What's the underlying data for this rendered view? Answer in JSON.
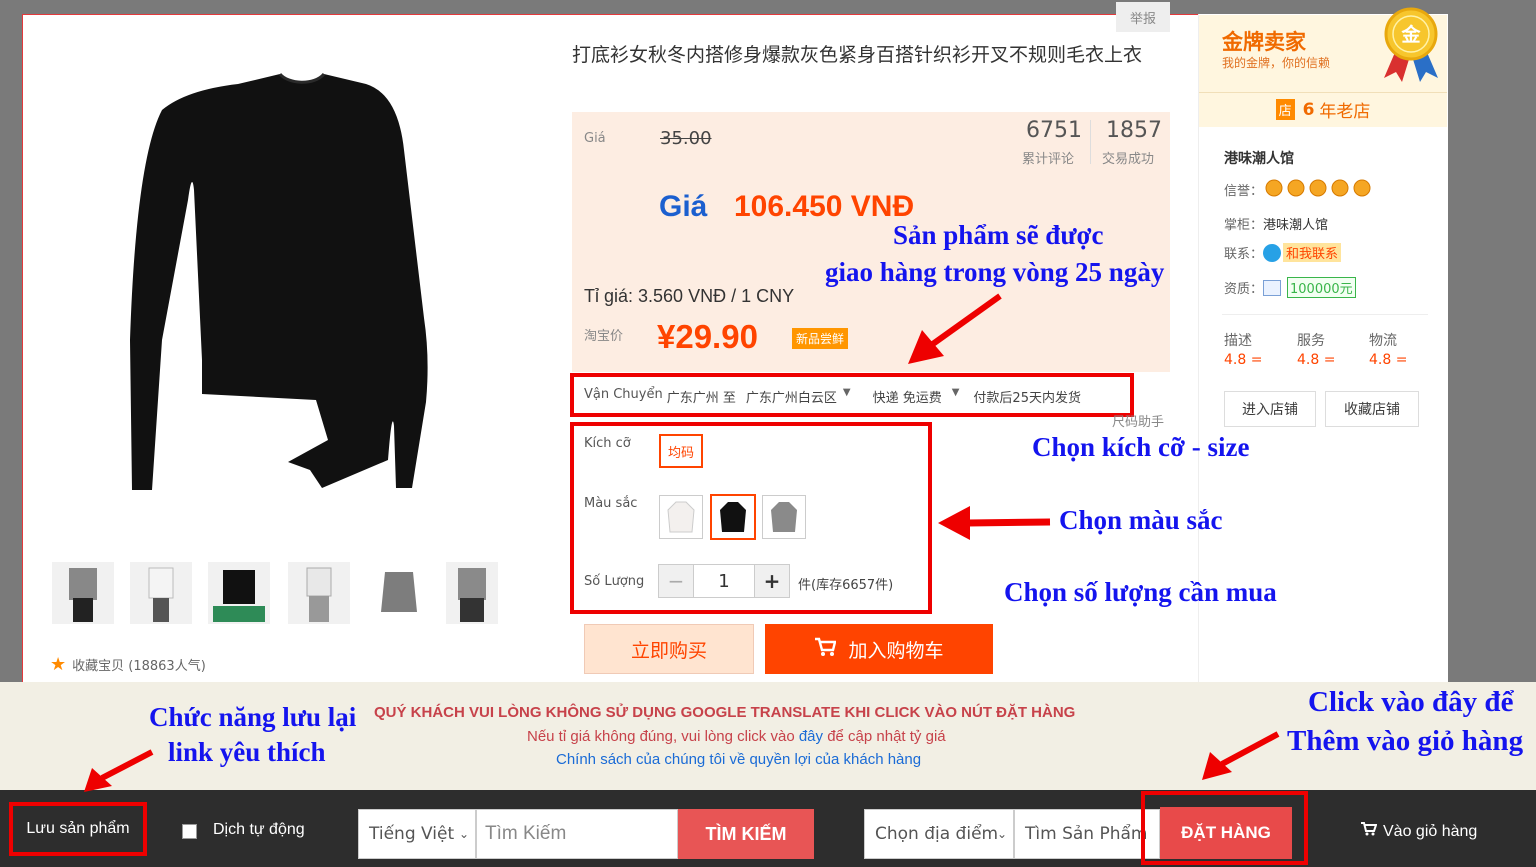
{
  "report": "举报",
  "product": {
    "title": "打底衫女秋冬内搭修身爆款灰色紧身百搭针织衫开叉不规则毛衣上衣"
  },
  "price": {
    "label": "Giá",
    "original": "35.00",
    "reviews_count": "6751",
    "reviews_label": "累计评论",
    "deals_count": "1857",
    "deals_label": "交易成功",
    "vnd_label": "Giá",
    "vnd_value": "106.450 VNĐ",
    "rate_text": "Tỉ giá: 3.560 VNĐ / 1 CNY",
    "taobao_label": "淘宝价",
    "taobao_price": "¥29.90",
    "new_tag": "新品尝鲜"
  },
  "shipping": {
    "label": "Vận Chuyển",
    "from": "广东广州 至",
    "to": "广东广州白云区",
    "method": "快递 免运费",
    "delivery": "付款后25天内发货",
    "size_helper": "尺码助手"
  },
  "options": {
    "size_label": "Kích cỡ",
    "size_value": "均码",
    "color_label": "Màu sắc",
    "qty_label": "Số Lượng",
    "qty_value": "1",
    "qty_minus": "−",
    "qty_plus": "+",
    "stock": "件(库存6657件)"
  },
  "actions": {
    "buy_now": "立即购买",
    "add_cart": "加入购物车"
  },
  "favorite": {
    "text": "收藏宝贝 (18863人气)"
  },
  "seller": {
    "badge_title": "金牌卖家",
    "badge_sub": "我的金牌，你的信赖",
    "badge_medal": "金",
    "years_icon": "店",
    "years_num": "6",
    "years_text": "年老店",
    "name": "港味潮人馆",
    "credit_label": "信誉：",
    "keeper_label": "掌柜：",
    "keeper_value": "港味潮人馆",
    "contact_label": "联系：",
    "contact_value": "和我联系",
    "qual_label": "资质：",
    "deposit": "100000元",
    "ratings": [
      {
        "label": "描述",
        "value": "4.8 ="
      },
      {
        "label": "服务",
        "value": "4.8 ="
      },
      {
        "label": "物流",
        "value": "4.8 ="
      }
    ],
    "enter_shop": "进入店铺",
    "save_shop": "收藏店铺"
  },
  "annotations": {
    "ship_line1": "Sản phẩm sẽ được",
    "ship_line2": "giao hàng trong vòng 25 ngày",
    "size": "Chọn kích cỡ - size",
    "color": "Chọn màu sắc",
    "qty": "Chọn số lượng cần mua",
    "save_line1": "Chức năng lưu lại",
    "save_line2": "link yêu thích",
    "order_line1": "Click vào đây để",
    "order_line2": "Thêm vào giỏ hàng"
  },
  "notice": {
    "warning": "QUÝ KHÁCH VUI LÒNG KHÔNG SỬ DỤNG GOOGLE TRANSLATE KHI CLICK VÀO NÚT ĐẶT HÀNG",
    "rate_before": "Nếu tỉ giá không đúng, vui lòng click vào",
    "rate_link": "đây",
    "rate_after": "để cập nhật tỷ giá",
    "policy": "Chính sách của chúng tôi về quyền lợi của khách hàng"
  },
  "toolbar": {
    "save": "Lưu sản phẩm",
    "auto_translate": "Dịch tự động",
    "language": "Tiếng Việt",
    "search_placeholder": "Tìm Kiếm",
    "search_button": "TÌM KIẾM",
    "location": "Chọn địa điểm",
    "find_product": "Tìm Sản Phẩm",
    "order": "ĐẶT HÀNG",
    "cart": "Vào giỏ hàng"
  },
  "colors": {
    "accent": "#ff4400",
    "red": "#e4393c",
    "annotation": "#1414ee",
    "toolbar_bg": "#2d2d2d"
  }
}
